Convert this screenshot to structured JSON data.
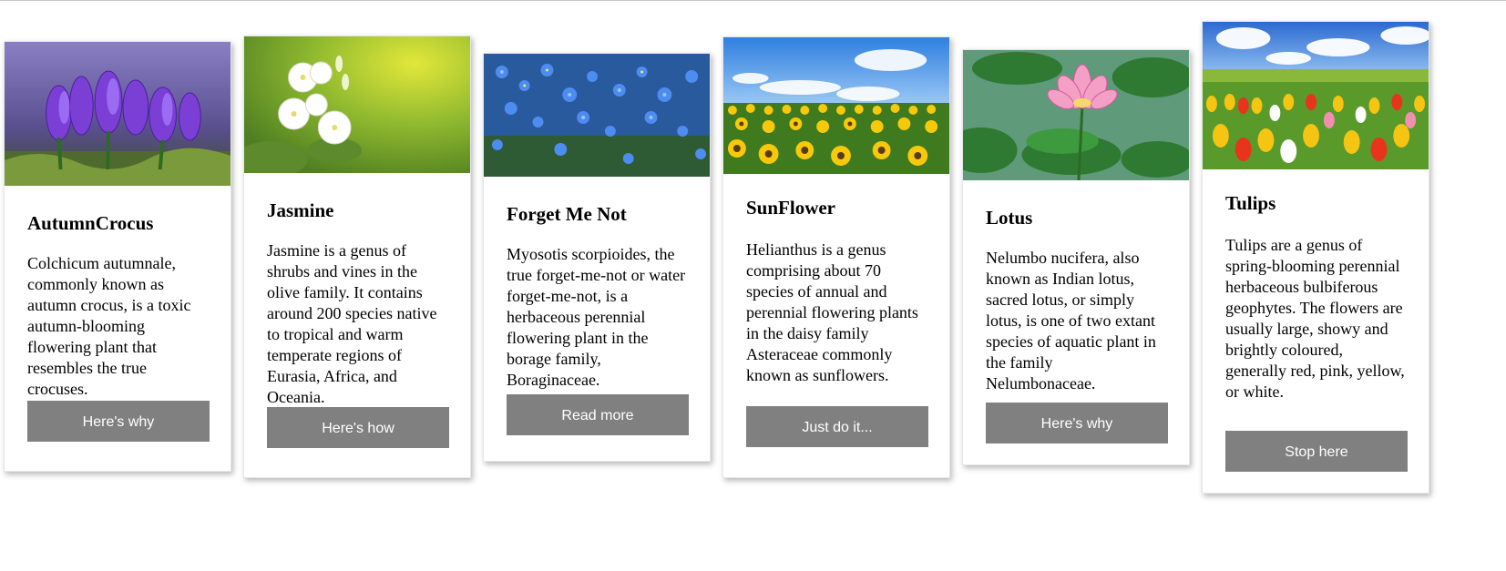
{
  "cards": [
    {
      "title": "AutumnCrocus",
      "description": "Colchicum autumnale, commonly known as autumn crocus, is a toxic autumn-blooming flowering plant that resembles the true crocuses.",
      "button": "Here's why",
      "image": "purple-crocus-flowers-photo"
    },
    {
      "title": "Jasmine",
      "description": "Jasmine is a genus of shrubs and vines in the olive family. It contains around 200 species native to tropical and warm temperate regions of Eurasia, Africa, and Oceania.",
      "button": "Here's how",
      "image": "white-jasmine-flowers-photo"
    },
    {
      "title": "Forget Me Not",
      "description": "Myosotis scorpioides, the true forget-me-not or water forget-me-not, is a herbaceous perennial flowering plant in the borage family, Boraginaceae.",
      "button": "Read more",
      "image": "blue-forget-me-not-flowers-photo"
    },
    {
      "title": "SunFlower",
      "description": "Helianthus is a genus comprising about 70 species of annual and perennial flowering plants in the daisy family Asteraceae commonly known as sunflowers.",
      "button": "Just do it...",
      "image": "sunflower-field-photo"
    },
    {
      "title": "Lotus",
      "description": "Nelumbo nucifera, also known as Indian lotus, sacred lotus, or simply lotus, is one of two extant species of aquatic plant in the family Nelumbonaceae.",
      "button": "Here's why",
      "image": "pink-lotus-flower-photo"
    },
    {
      "title": "Tulips",
      "description": "Tulips are a genus of spring-blooming perennial herbaceous bulbiferous geophytes. The flowers are usually large, showy and brightly coloured, generally red, pink, yellow, or white.",
      "button": "Stop here",
      "image": "tulip-field-photo"
    }
  ],
  "colors": {
    "button_bg": "#808080",
    "button_text": "#ffffff",
    "card_bg": "#ffffff"
  }
}
